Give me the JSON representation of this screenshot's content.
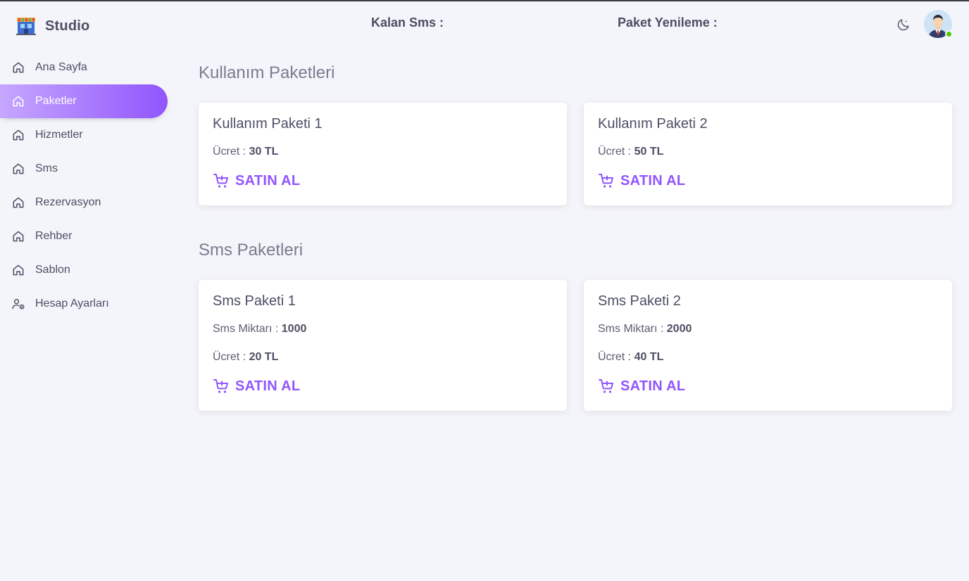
{
  "app": {
    "brand_name": "Studio"
  },
  "sidebar": {
    "items": [
      {
        "label": "Ana Sayfa",
        "icon": "home-icon",
        "active": false
      },
      {
        "label": "Paketler",
        "icon": "home-icon",
        "active": true
      },
      {
        "label": "Hizmetler",
        "icon": "home-icon",
        "active": false
      },
      {
        "label": "Sms",
        "icon": "home-icon",
        "active": false
      },
      {
        "label": "Rezervasyon",
        "icon": "home-icon",
        "active": false
      },
      {
        "label": "Rehber",
        "icon": "home-icon",
        "active": false
      },
      {
        "label": "Sablon",
        "icon": "home-icon",
        "active": false
      },
      {
        "label": "Hesap Ayarları",
        "icon": "account-cog-icon",
        "active": false
      }
    ]
  },
  "header": {
    "sms_left_label": "Kalan Sms :",
    "renewal_label": "Paket Yenileme :",
    "theme_icon": "moon-icon",
    "avatar_status": "online"
  },
  "usage_packages": {
    "title": "Kullanım Paketleri",
    "items": [
      {
        "name": "Kullanım Paketi 1",
        "price_label": "Ücret : ",
        "price": "30 TL",
        "buy_label": "SATIN AL"
      },
      {
        "name": "Kullanım Paketi 2",
        "price_label": "Ücret : ",
        "price": "50 TL",
        "buy_label": "SATIN AL"
      }
    ]
  },
  "sms_packages": {
    "title": "Sms Paketleri",
    "items": [
      {
        "name": "Sms Paketi 1",
        "amount_label": "Sms Miktarı : ",
        "amount": "1000",
        "price_label": "Ücret : ",
        "price": "20 TL",
        "buy_label": "SATIN AL"
      },
      {
        "name": "Sms Paketi 2",
        "amount_label": "Sms Miktarı : ",
        "amount": "2000",
        "price_label": "Ücret : ",
        "price": "40 TL",
        "buy_label": "SATIN AL"
      }
    ]
  },
  "colors": {
    "accent": "#9155fd",
    "background": "#f4f5fa",
    "text": "#4c4e64",
    "online": "#56ca00"
  }
}
